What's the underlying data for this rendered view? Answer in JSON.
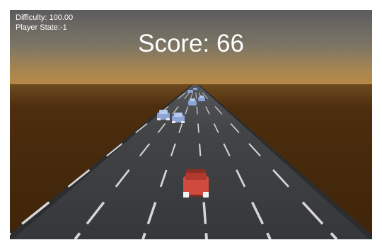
{
  "hud": {
    "difficulty_text": "Difficulty: 100.00",
    "player_state_text": "Player State:-1",
    "score_text": "Score: 66"
  },
  "colors": {
    "sky_top": "#5d5e5f",
    "sky_horizon": "#b2884c",
    "ground": "#4a2b0c",
    "road": "#3b3d3f",
    "lane_marking": "#d9d9d9",
    "player_car": "#c8463a",
    "traffic_car": "#8fa6d8"
  },
  "icons": {
    "player": "red-car-icon",
    "traffic": "blue-car-icon"
  }
}
